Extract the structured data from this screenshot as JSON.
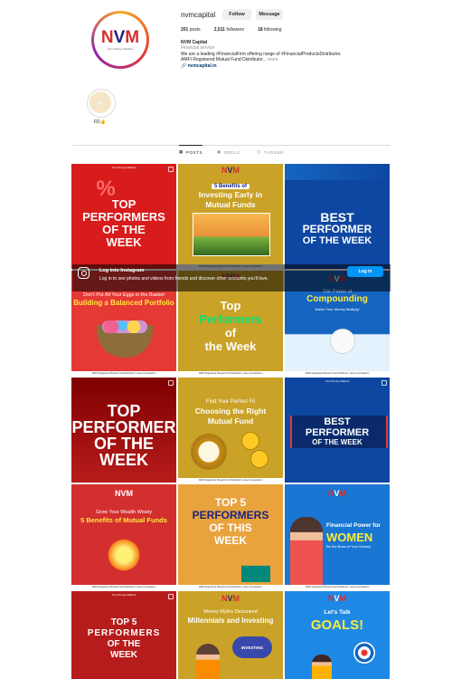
{
  "profile": {
    "username": "nvmcapital",
    "follow_label": "Follow",
    "message_label": "Message",
    "posts_count": "201",
    "posts_label": "posts",
    "followers_count": "2,511",
    "followers_label": "followers",
    "following_count": "18",
    "following_label": "following",
    "name": "NVM Capital",
    "category": "Financial service",
    "bio_line1": "We are a leading #FinancialFirm offering range of #FinancialProductsDistributor.",
    "bio_line2": "AMFI Registered Mutual Fund Distributor...",
    "bio_more": "more",
    "link": "nvmcapital.in",
    "logo_n": "N",
    "logo_v": "V",
    "logo_m": "M",
    "logo_tagline": "Your Money Matters"
  },
  "highlight": {
    "label": "FD"
  },
  "tabs": [
    {
      "label": "POSTS",
      "icon": "grid-icon",
      "active": true
    },
    {
      "label": "REELS",
      "icon": "reels-icon",
      "active": false
    },
    {
      "label": "TAGGED",
      "icon": "tagged-icon",
      "active": false
    }
  ],
  "overlay": {
    "title": "Log into Instagram",
    "subtitle": "Log in to see photos and videos from friends and discover other accounts you'll love.",
    "login_label": "Log in"
  },
  "posts": {
    "p1": {
      "tag": "Your Money Matters",
      "l1": "TOP",
      "l2": "PERFORMERS",
      "l3": "OF THE",
      "l4": "WEEK"
    },
    "p2": {
      "l1": "5 Benefits of",
      "l2": "Investing Early in",
      "l3": "Mutual Funds"
    },
    "p3": {
      "l1": "BEST",
      "l2": "PERFORMER",
      "l3": "OF THE WEEK"
    },
    "p4": {
      "l1": "Don't Put All Your Eggs in the Basket",
      "l2": "Building a Balanced Portfolio"
    },
    "p5": {
      "l1": "Top",
      "l2": "Performers",
      "l3": "of",
      "l4": "the Week"
    },
    "p6": {
      "l1": "The Power of",
      "l2": "Compounding",
      "l3": "Watch Your Money Multiply!"
    },
    "p7": {
      "l1": "TOP",
      "l2": "PERFORMER",
      "l3": "OF THE",
      "l4": "WEEK"
    },
    "p8": {
      "l1": "Find Your Perfect Fit",
      "l2": "Choosing the Right",
      "l3": "Mutual Fund"
    },
    "p9": {
      "tag": "Your Money Matters",
      "l1": "BEST",
      "l2": "PERFORMER",
      "l3": "OF THE WEEK"
    },
    "p10": {
      "l1": "Grow Your Wealth Wisely",
      "l2": "5 Benefits of Mutual Funds"
    },
    "p11": {
      "l1": "TOP 5",
      "l2": "PERFORMERS",
      "l3": "OF THIS",
      "l4": "WEEK"
    },
    "p12": {
      "l1": "Financial Power for",
      "l2": "WOMEN",
      "l3": "Be the Boss of Your Money!"
    },
    "p13": {
      "tag": "Your Money Matters",
      "l1": "TOP 5",
      "l2": "PERFORMERS",
      "l3": "OF THE",
      "l4": "WEEK"
    },
    "p14": {
      "l1": "Money Myths Debunked",
      "l2": "Millennials and Investing",
      "l3": "INVESTING"
    },
    "p15": {
      "l1": "Let's Talk",
      "l2": "GOALS!"
    }
  },
  "footer_text": "AMFI Registered Mutual Fund Distributor | www.nvmcapital.in",
  "colors": {
    "red": "#d32f2f",
    "navy": "#1a237e",
    "gold": "#c9a227",
    "blue": "#0d47a1",
    "ig_blue": "#0095f6"
  }
}
